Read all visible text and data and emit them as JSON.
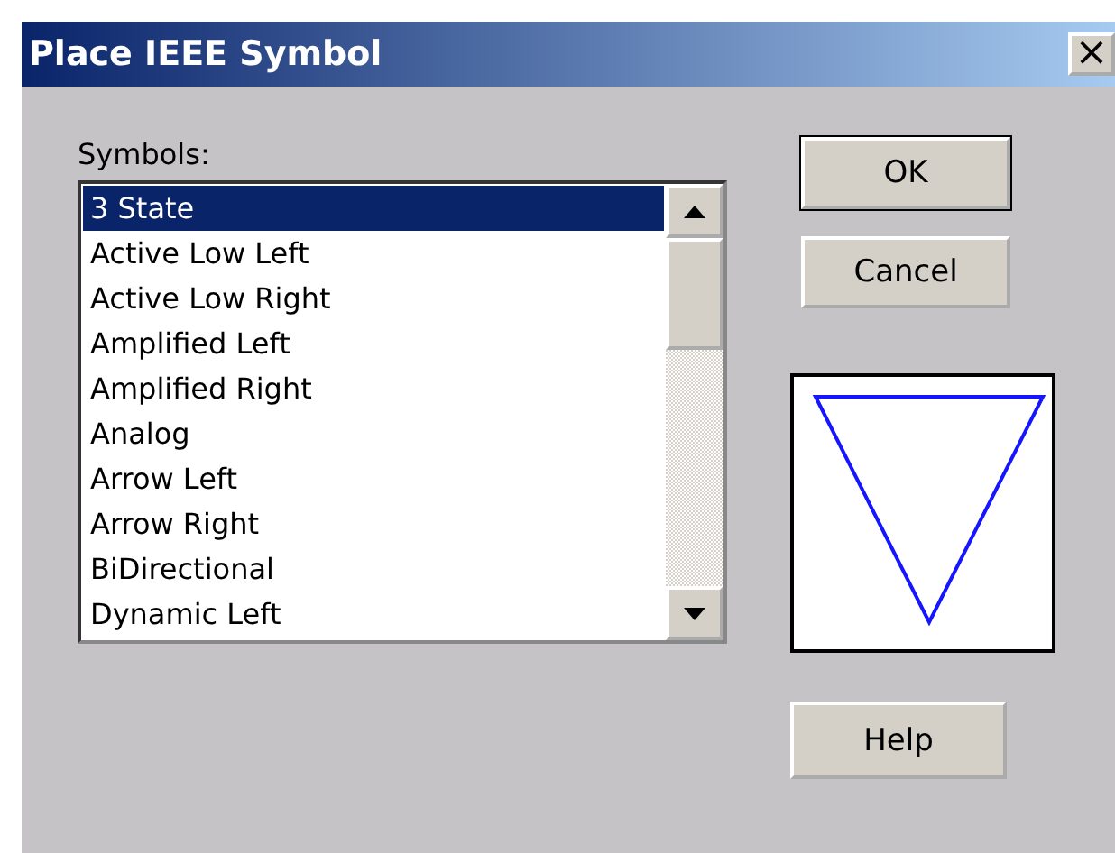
{
  "window": {
    "title": "Place IEEE Symbol",
    "close": "×"
  },
  "symbols": {
    "label": "Symbols:",
    "items": [
      {
        "text": "3 State",
        "selected": true
      },
      {
        "text": "Active Low Left",
        "selected": false
      },
      {
        "text": "Active Low Right",
        "selected": false
      },
      {
        "text": "Amplified Left",
        "selected": false
      },
      {
        "text": "Amplified Right",
        "selected": false
      },
      {
        "text": "Analog",
        "selected": false
      },
      {
        "text": "Arrow Left",
        "selected": false
      },
      {
        "text": "Arrow Right",
        "selected": false
      },
      {
        "text": "BiDirectional",
        "selected": false
      },
      {
        "text": "Dynamic Left",
        "selected": false
      }
    ]
  },
  "buttons": [
    {
      "label": "OK",
      "default": true
    },
    {
      "label": "Cancel",
      "default": false
    }
  ],
  "help_button": "Help"
}
